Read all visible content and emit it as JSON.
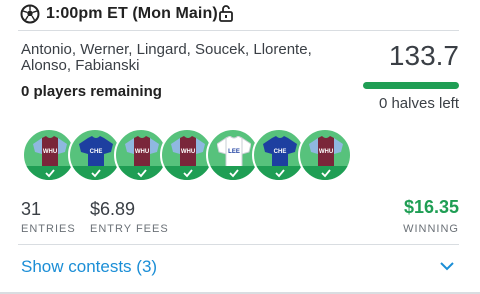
{
  "header": {
    "title": "1:00pm ET (Mon Main)",
    "sport_icon": "soccer-ball-icon",
    "lock_icon": "unlock-icon"
  },
  "lineup": {
    "players": "Antonio, Werner, Lingard, Soucek, Llorente, Alonso, Fabianski",
    "remaining": "0 players remaining",
    "points": "133.7",
    "halves_left": "0 halves left",
    "progress_fraction": 1.0,
    "jerseys": [
      {
        "team": "WHU",
        "color": "#7a263a",
        "sleeve": "#8fb8e0",
        "status": "check-icon"
      },
      {
        "team": "CHE",
        "color": "#1d3fa0",
        "sleeve": "#1d3fa0",
        "status": "check-icon"
      },
      {
        "team": "WHU",
        "color": "#7a263a",
        "sleeve": "#8fb8e0",
        "status": "check-icon"
      },
      {
        "team": "WHU",
        "color": "#7a263a",
        "sleeve": "#8fb8e0",
        "status": "check-icon"
      },
      {
        "team": "LEE",
        "color": "#ffffff",
        "sleeve": "#ffffff",
        "status": "check-icon"
      },
      {
        "team": "CHE",
        "color": "#1d3fa0",
        "sleeve": "#1d3fa0",
        "status": "check-icon"
      },
      {
        "team": "WHU",
        "color": "#7a263a",
        "sleeve": "#8fb8e0",
        "status": "check-icon"
      }
    ]
  },
  "stats": {
    "entries_value": "31",
    "entries_label": "ENTRIES",
    "fees_value": "$6.89",
    "fees_label": "ENTRY FEES",
    "winning_value": "$16.35",
    "winning_label": "WINNING"
  },
  "footer": {
    "show_contests": "Show contests (3)",
    "chevron_icon": "chevron-down-icon"
  },
  "colors": {
    "accent_green": "#1f9e54",
    "link_blue": "#1b8ed6",
    "jersey_bg": "#57c27c"
  }
}
